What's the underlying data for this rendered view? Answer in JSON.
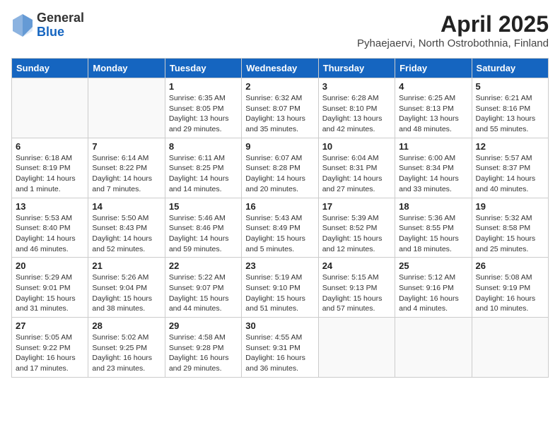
{
  "header": {
    "logo_general": "General",
    "logo_blue": "Blue",
    "title": "April 2025",
    "subtitle": "Pyhaejaervi, North Ostrobothnia, Finland"
  },
  "calendar": {
    "days_of_week": [
      "Sunday",
      "Monday",
      "Tuesday",
      "Wednesday",
      "Thursday",
      "Friday",
      "Saturday"
    ],
    "weeks": [
      [
        {
          "day": "",
          "info": ""
        },
        {
          "day": "",
          "info": ""
        },
        {
          "day": "1",
          "info": "Sunrise: 6:35 AM\nSunset: 8:05 PM\nDaylight: 13 hours and 29 minutes."
        },
        {
          "day": "2",
          "info": "Sunrise: 6:32 AM\nSunset: 8:07 PM\nDaylight: 13 hours and 35 minutes."
        },
        {
          "day": "3",
          "info": "Sunrise: 6:28 AM\nSunset: 8:10 PM\nDaylight: 13 hours and 42 minutes."
        },
        {
          "day": "4",
          "info": "Sunrise: 6:25 AM\nSunset: 8:13 PM\nDaylight: 13 hours and 48 minutes."
        },
        {
          "day": "5",
          "info": "Sunrise: 6:21 AM\nSunset: 8:16 PM\nDaylight: 13 hours and 55 minutes."
        }
      ],
      [
        {
          "day": "6",
          "info": "Sunrise: 6:18 AM\nSunset: 8:19 PM\nDaylight: 14 hours and 1 minute."
        },
        {
          "day": "7",
          "info": "Sunrise: 6:14 AM\nSunset: 8:22 PM\nDaylight: 14 hours and 7 minutes."
        },
        {
          "day": "8",
          "info": "Sunrise: 6:11 AM\nSunset: 8:25 PM\nDaylight: 14 hours and 14 minutes."
        },
        {
          "day": "9",
          "info": "Sunrise: 6:07 AM\nSunset: 8:28 PM\nDaylight: 14 hours and 20 minutes."
        },
        {
          "day": "10",
          "info": "Sunrise: 6:04 AM\nSunset: 8:31 PM\nDaylight: 14 hours and 27 minutes."
        },
        {
          "day": "11",
          "info": "Sunrise: 6:00 AM\nSunset: 8:34 PM\nDaylight: 14 hours and 33 minutes."
        },
        {
          "day": "12",
          "info": "Sunrise: 5:57 AM\nSunset: 8:37 PM\nDaylight: 14 hours and 40 minutes."
        }
      ],
      [
        {
          "day": "13",
          "info": "Sunrise: 5:53 AM\nSunset: 8:40 PM\nDaylight: 14 hours and 46 minutes."
        },
        {
          "day": "14",
          "info": "Sunrise: 5:50 AM\nSunset: 8:43 PM\nDaylight: 14 hours and 52 minutes."
        },
        {
          "day": "15",
          "info": "Sunrise: 5:46 AM\nSunset: 8:46 PM\nDaylight: 14 hours and 59 minutes."
        },
        {
          "day": "16",
          "info": "Sunrise: 5:43 AM\nSunset: 8:49 PM\nDaylight: 15 hours and 5 minutes."
        },
        {
          "day": "17",
          "info": "Sunrise: 5:39 AM\nSunset: 8:52 PM\nDaylight: 15 hours and 12 minutes."
        },
        {
          "day": "18",
          "info": "Sunrise: 5:36 AM\nSunset: 8:55 PM\nDaylight: 15 hours and 18 minutes."
        },
        {
          "day": "19",
          "info": "Sunrise: 5:32 AM\nSunset: 8:58 PM\nDaylight: 15 hours and 25 minutes."
        }
      ],
      [
        {
          "day": "20",
          "info": "Sunrise: 5:29 AM\nSunset: 9:01 PM\nDaylight: 15 hours and 31 minutes."
        },
        {
          "day": "21",
          "info": "Sunrise: 5:26 AM\nSunset: 9:04 PM\nDaylight: 15 hours and 38 minutes."
        },
        {
          "day": "22",
          "info": "Sunrise: 5:22 AM\nSunset: 9:07 PM\nDaylight: 15 hours and 44 minutes."
        },
        {
          "day": "23",
          "info": "Sunrise: 5:19 AM\nSunset: 9:10 PM\nDaylight: 15 hours and 51 minutes."
        },
        {
          "day": "24",
          "info": "Sunrise: 5:15 AM\nSunset: 9:13 PM\nDaylight: 15 hours and 57 minutes."
        },
        {
          "day": "25",
          "info": "Sunrise: 5:12 AM\nSunset: 9:16 PM\nDaylight: 16 hours and 4 minutes."
        },
        {
          "day": "26",
          "info": "Sunrise: 5:08 AM\nSunset: 9:19 PM\nDaylight: 16 hours and 10 minutes."
        }
      ],
      [
        {
          "day": "27",
          "info": "Sunrise: 5:05 AM\nSunset: 9:22 PM\nDaylight: 16 hours and 17 minutes."
        },
        {
          "day": "28",
          "info": "Sunrise: 5:02 AM\nSunset: 9:25 PM\nDaylight: 16 hours and 23 minutes."
        },
        {
          "day": "29",
          "info": "Sunrise: 4:58 AM\nSunset: 9:28 PM\nDaylight: 16 hours and 29 minutes."
        },
        {
          "day": "30",
          "info": "Sunrise: 4:55 AM\nSunset: 9:31 PM\nDaylight: 16 hours and 36 minutes."
        },
        {
          "day": "",
          "info": ""
        },
        {
          "day": "",
          "info": ""
        },
        {
          "day": "",
          "info": ""
        }
      ]
    ]
  }
}
